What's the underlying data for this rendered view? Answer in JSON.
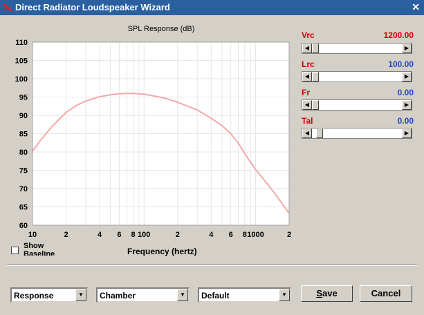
{
  "window": {
    "title": "Direct Radiator Loudspeaker Wizard",
    "colors": {
      "titlebar": "#2a5fa0",
      "param_label": "#cc0000",
      "curve": "#f4a8a8"
    }
  },
  "chart_data": {
    "type": "line",
    "title": "SPL Response (dB)",
    "xlabel": "Frequency (hertz)",
    "ylabel": "",
    "xscale": "log",
    "xlim": [
      10,
      2000
    ],
    "ylim": [
      60,
      110
    ],
    "yticks": [
      "110",
      "105",
      "100",
      "95",
      "90",
      "85",
      "80",
      "75",
      "70",
      "65",
      "60"
    ],
    "xticks": [
      "10",
      "2",
      "4",
      "6",
      "8",
      "100",
      "2",
      "4",
      "6",
      "8",
      "1000",
      "2"
    ],
    "grid": true,
    "series": [
      {
        "x": [
          10,
          12,
          15,
          20,
          25,
          30,
          40,
          50,
          60,
          70,
          80,
          100,
          150,
          200,
          300,
          400,
          500,
          600,
          700,
          800,
          900,
          1000,
          1200,
          1500,
          1700,
          2000
        ],
        "y": [
          80.2,
          83.5,
          87,
          90.8,
          92.8,
          93.9,
          95.1,
          95.6,
          95.9,
          96,
          96,
          95.8,
          94.8,
          93.6,
          91.5,
          89.2,
          87.2,
          85,
          82.4,
          79.6,
          77.2,
          75.2,
          72.3,
          68.5,
          66.2,
          63.2
        ]
      }
    ]
  },
  "params": [
    {
      "label": "Vrc",
      "value": "1200.00",
      "color": "red",
      "slider": 0.0
    },
    {
      "label": "Lrc",
      "value": "100.00",
      "color": "blue",
      "slider": 0.0
    },
    {
      "label": "Fr",
      "value": "0.00",
      "color": "blue",
      "slider": 0.0
    },
    {
      "label": "Tal",
      "value": "0.00",
      "color": "blue",
      "slider": 0.05
    }
  ],
  "show_baseline": {
    "label": "Show Baseline",
    "checked": false
  },
  "selects": {
    "view": "Response",
    "enclosure": "Chamber",
    "preset": "Default"
  },
  "buttons": {
    "save_prefix": "S",
    "save_rest": "ave",
    "cancel": "Cancel"
  }
}
